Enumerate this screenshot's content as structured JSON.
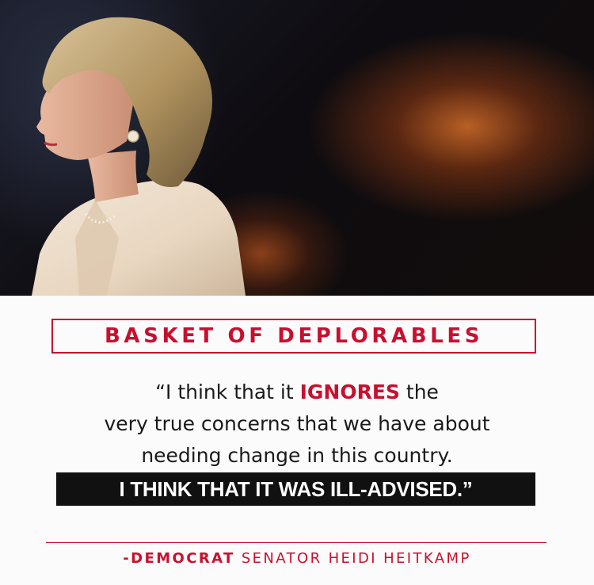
{
  "headline": {
    "title": "BASKET OF DEPLORABLES"
  },
  "quote": {
    "line1_before": "“I think that it ",
    "line1_emphasis": "IGNORES",
    "line1_after": " the",
    "line2": "very true concerns that we have about",
    "line3": "needing change in this country.",
    "line4_highlight": "I THINK THAT IT WAS ILL-ADVISED.”"
  },
  "attribution": {
    "party": "-DEMOCRAT",
    "rest": " SENATOR HEIDI HEITKAMP"
  },
  "colors": {
    "accent_red": "#c8102e",
    "bar_black": "#111111",
    "text_dark": "#1a1a1a"
  }
}
